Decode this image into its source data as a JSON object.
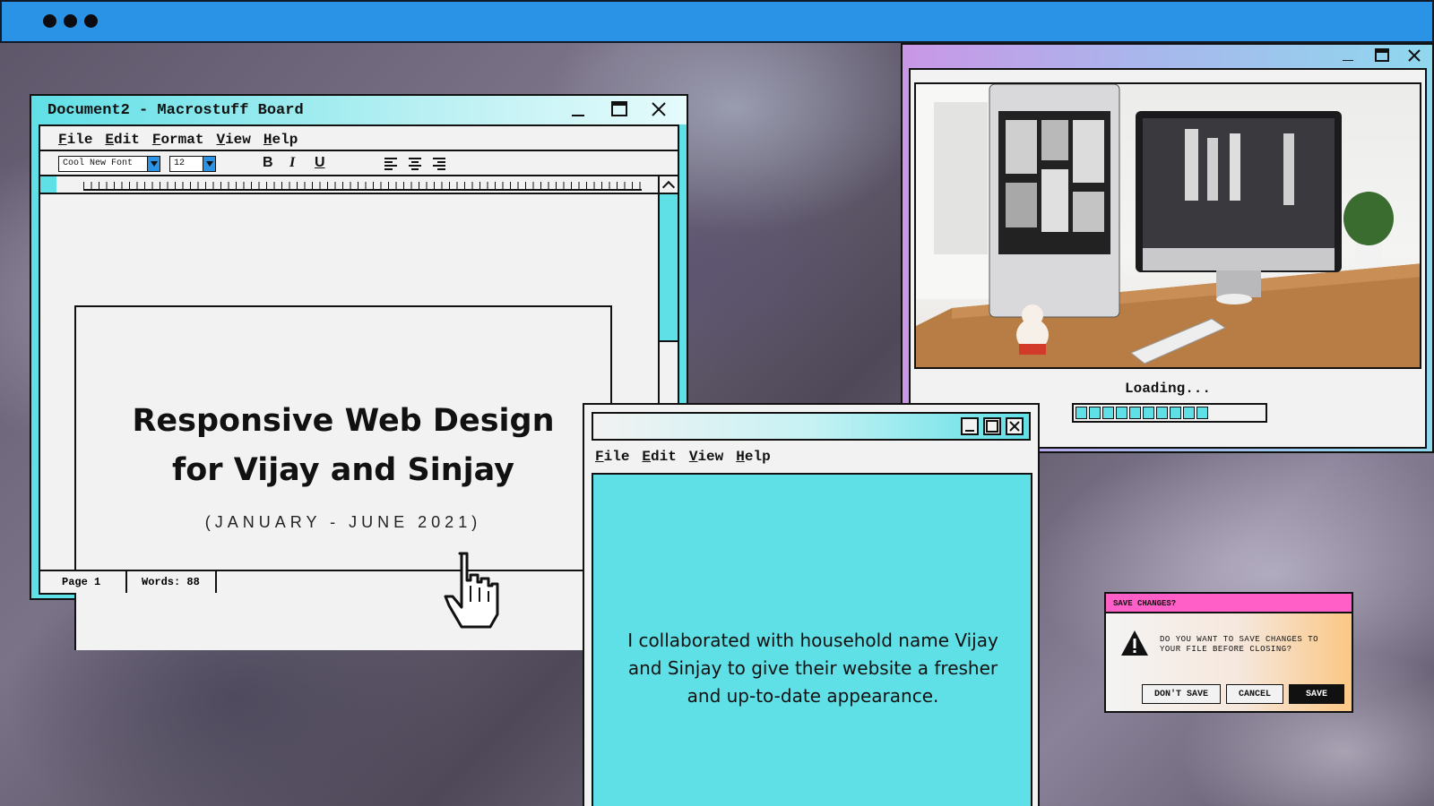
{
  "doc_window": {
    "title": "Document2 - Macrostuff Board",
    "menu": [
      "File",
      "Edit",
      "Format",
      "View",
      "Help"
    ],
    "font_select": "Cool New Font",
    "size_select": "12",
    "format_buttons": [
      "B",
      "I",
      "U"
    ],
    "heading_line1": "Responsive Web Design",
    "heading_line2": "for Vijay and Sinjay",
    "subtitle": "(JANUARY - JUNE 2021)",
    "status_page": "Page 1",
    "status_words": "Words: 88"
  },
  "photo_window": {
    "loading_text": "Loading...",
    "progress_fraction": 0.6,
    "progress_segments_filled": 10
  },
  "note_window": {
    "menu": [
      "File",
      "Edit",
      "View",
      "Help"
    ],
    "text": "I collaborated with household name Vijay and Sinjay to give their website a fresher and up-to-date appearance."
  },
  "dialog": {
    "title": "SAVE CHANGES?",
    "message": "DO YOU WANT TO SAVE CHANGES TO YOUR FILE BEFORE CLOSING?",
    "buttons": {
      "dont_save": "DON'T SAVE",
      "cancel": "CANCEL",
      "save": "SAVE"
    }
  },
  "colors": {
    "topbar": "#2b93e6",
    "cyan": "#5fe0e6",
    "pink": "#ff5fc6",
    "orange": "#fbc784",
    "ink": "#111111"
  },
  "icons": [
    "minimize-icon",
    "maximize-icon",
    "close-icon",
    "bold-icon",
    "italic-icon",
    "underline-icon",
    "align-left-icon",
    "align-center-icon",
    "align-right-icon",
    "warning-icon",
    "hand-cursor-icon"
  ]
}
